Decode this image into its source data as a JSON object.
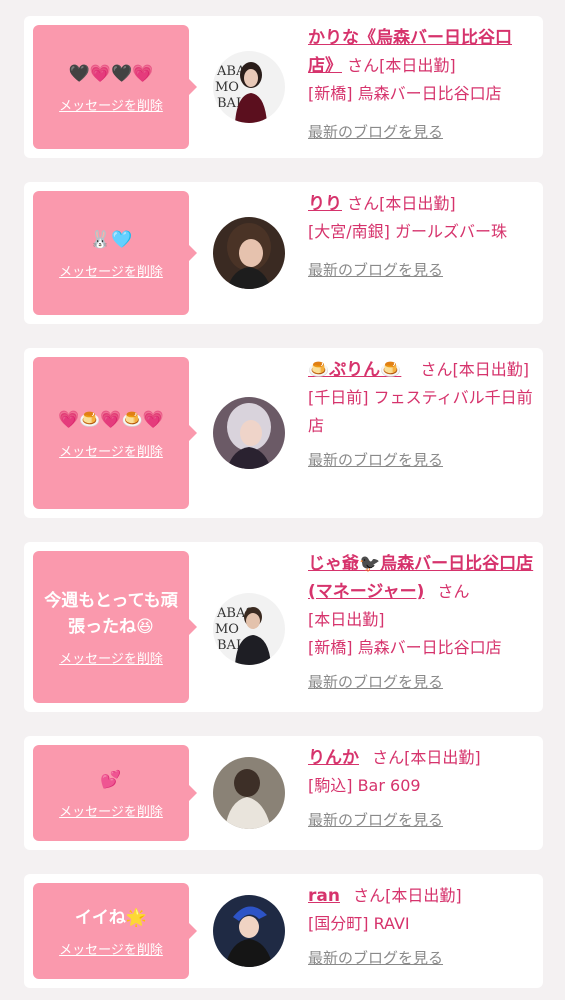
{
  "delete_label": "メッセージを削除",
  "blog_label": "最新のブログを見る",
  "honorific": "さん",
  "cards": [
    {
      "message": "🖤💗🖤💗",
      "name": "かりな《烏森バー日比谷口店》",
      "status": "[本日出勤]",
      "area_shop": "[新橋] 烏森バー日比谷口店",
      "avatar_icon": "woman-portrait-icon"
    },
    {
      "message": "🐰🩵",
      "name": "りり",
      "status": "[本日出勤]",
      "area_shop": "[大宮/南銀] ガールズバー珠",
      "avatar_icon": "woman-portrait-icon"
    },
    {
      "message": "💗🍮💗🍮💗",
      "name": "🍮ぷりん🍮",
      "status": "[本日出勤]",
      "area_shop": "[千日前] フェスティバル千日前店",
      "avatar_icon": "woman-portrait-icon"
    },
    {
      "message": "今週もとっても頑張ったね😆",
      "name": "じゃ爺🐦‍⬛烏森バー日比谷口店(マネージャー)",
      "status": "[本日出勤]",
      "area_shop": "[新橋] 烏森バー日比谷口店",
      "avatar_icon": "man-portrait-icon"
    },
    {
      "message": "💕",
      "name": "りんか",
      "status": "[本日出勤]",
      "area_shop": "[駒込] Bar 609",
      "avatar_icon": "woman-portrait-icon"
    },
    {
      "message": "イイね🌟",
      "name": "ran",
      "status": "[本日出勤]",
      "area_shop": "[国分町] RAVI",
      "avatar_icon": "woman-portrait-icon"
    }
  ]
}
